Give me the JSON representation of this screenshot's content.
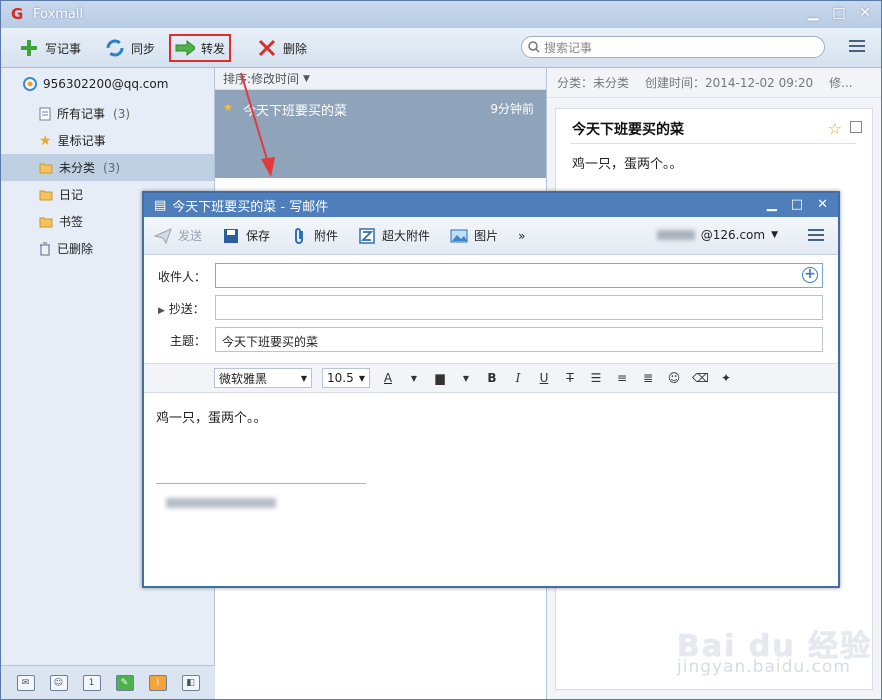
{
  "app": {
    "title": "Foxmail"
  },
  "window_controls": {
    "minimize": "▁",
    "maximize": "□",
    "close": "✕"
  },
  "toolbar": {
    "write_label": "写记事",
    "sync_label": "同步",
    "forward_label": "转发",
    "delete_label": "删除",
    "search_placeholder": "搜索记事"
  },
  "sidebar": {
    "account": "956302200@qq.com",
    "items": [
      {
        "label": "所有记事",
        "count": "(3)"
      },
      {
        "label": "星标记事",
        "count": ""
      },
      {
        "label": "未分类",
        "count": "(3)"
      },
      {
        "label": "日记",
        "count": ""
      },
      {
        "label": "书签",
        "count": ""
      },
      {
        "label": "已删除",
        "count": ""
      }
    ]
  },
  "list": {
    "sort_label": "排序:修改时间",
    "item": {
      "title": "今天下班要买的菜",
      "time": "9分钟前"
    }
  },
  "preview": {
    "category": "分类：未分类",
    "created": "创建时间：2014-12-02 09:20",
    "more": "修...",
    "title": "今天下班要买的菜",
    "body": "鸡一只，蛋两个。。"
  },
  "compose": {
    "title": "今天下班要买的菜 - 写邮件",
    "send_label": "发送",
    "save_label": "保存",
    "attach_label": "附件",
    "big_attach_label": "超大附件",
    "image_label": "图片",
    "more_label": "»",
    "sender_domain": "@126.com",
    "to_label": "收件人：",
    "cc_label": "抄送：",
    "subject_label": "主题：",
    "subject_value": "今天下班要买的菜",
    "font_family": "微软雅黑",
    "font_size": "10.5",
    "body": "鸡一只，蛋两个。。"
  },
  "watermark": {
    "brand": "Bai du 经验",
    "url": "jingyan.baidu.com"
  },
  "colors": {
    "accent": "#4e7fbb",
    "highlight_border": "#e02d2d",
    "selected_item": "#8fa3bb"
  }
}
